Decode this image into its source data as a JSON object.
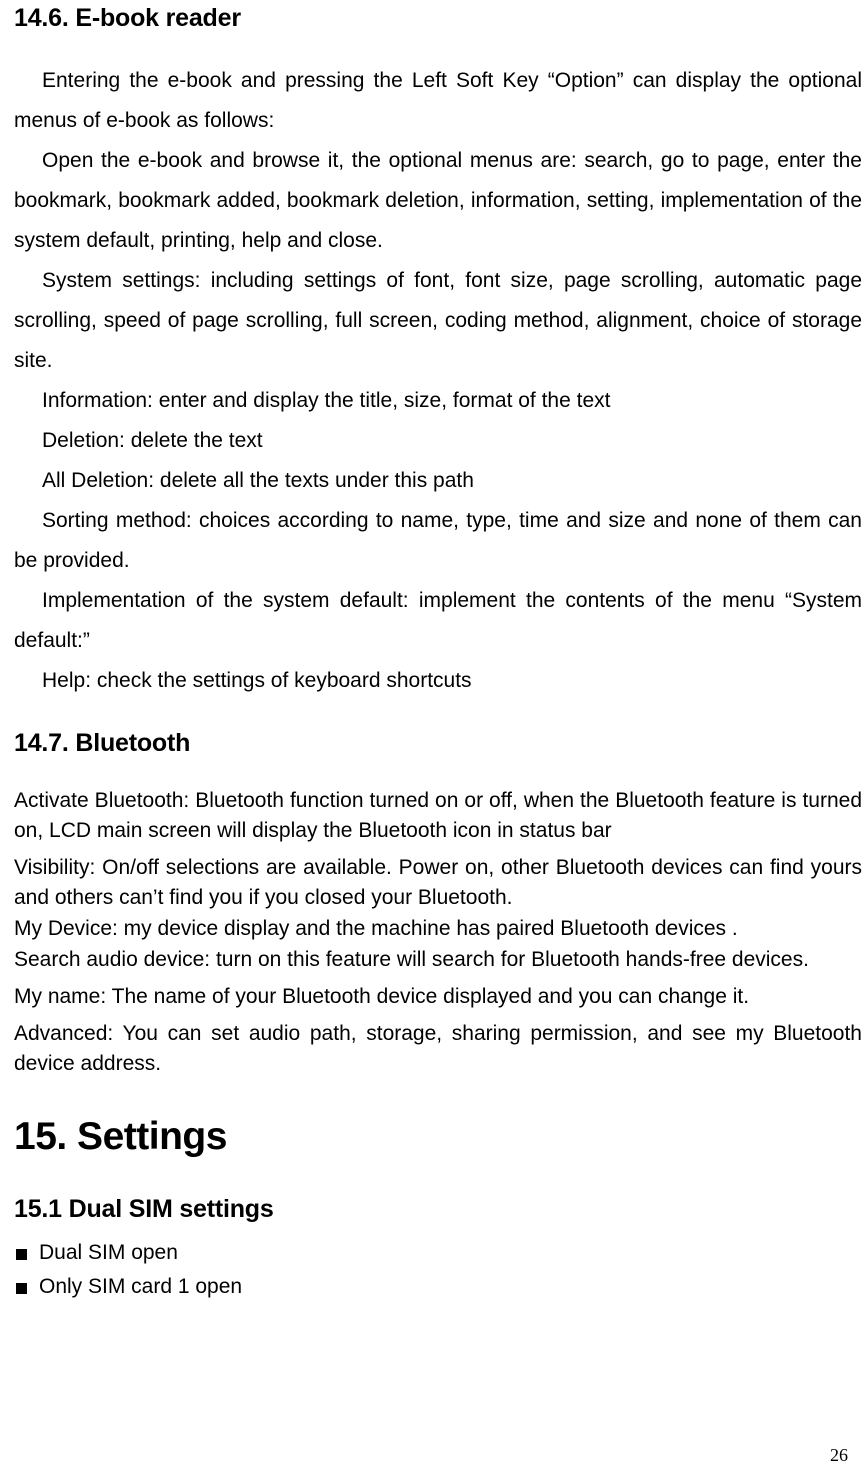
{
  "sections": {
    "ebook": {
      "heading": "14.6. E-book reader",
      "p1": "Entering the e-book and pressing the Left Soft Key “Option” can display the optional menus of e-book as follows:",
      "p2": "Open the e-book and browse it, the optional menus are: search, go to page, enter the bookmark, bookmark added, bookmark deletion, information, setting, implementation of the system default, printing, help and close.",
      "p3": "System settings: including settings of font, font size, page scrolling, automatic page scrolling, speed of page scrolling, full screen, coding method, alignment, choice of storage site.",
      "p4": "Information: enter and display the title, size, format of the text",
      "p5": "Deletion: delete the text",
      "p6": "All Deletion: delete all the texts under this path",
      "p7": "Sorting method: choices according to name, type, time and size and none of them can be provided.",
      "p8": "Implementation of the system default: implement the contents of the menu “System default:”",
      "p9": "Help: check the settings of keyboard shortcuts"
    },
    "bluetooth": {
      "heading": "14.7. Bluetooth",
      "p1": "Activate Bluetooth: Bluetooth function turned on or off, when the Bluetooth feature is turned on, LCD main screen will display the Bluetooth icon in status bar",
      "p2": "Visibility: On/off selections are available. Power on, other Bluetooth devices can find yours and others can’t find you if you closed your Bluetooth.",
      "p3": "My Device: my device display and the machine has paired Bluetooth devices .",
      "p4": "Search audio device: turn on this feature will search for Bluetooth hands-free devices.",
      "p5": "My name: The name of your Bluetooth device displayed and you can change it.",
      "p6": "Advanced: You can set audio path, storage, sharing permission, and see my Bluetooth device address."
    },
    "settings": {
      "heading": "15.  Settings"
    },
    "dualsim": {
      "heading": "15.1    Dual SIM settings",
      "items": [
        "Dual SIM open",
        "Only SIM card 1 open"
      ]
    }
  },
  "page_number": "26"
}
